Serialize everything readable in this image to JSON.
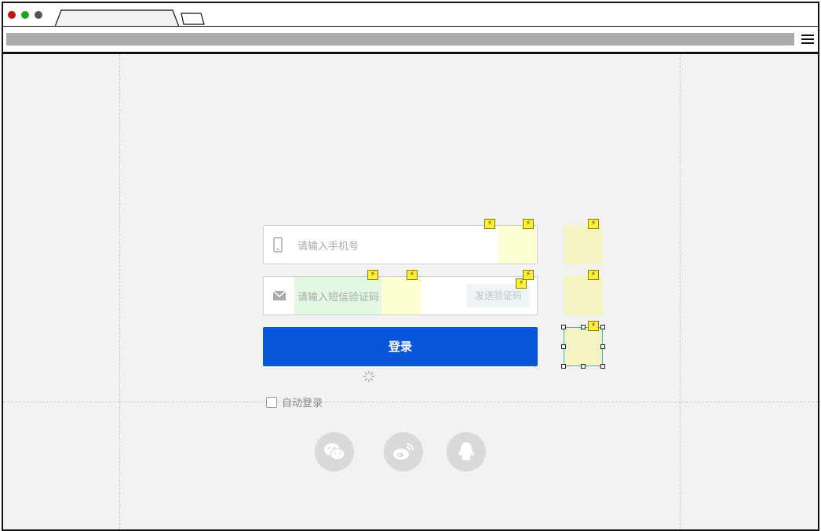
{
  "browser": {
    "dots": [
      "#c0170c",
      "#22a21e",
      "#555555"
    ]
  },
  "form": {
    "phone_placeholder": "请输入手机号",
    "code_placeholder": "请输入短信验证码",
    "send_code_label": "发送验证码",
    "login_label": "登录",
    "auto_login_label": "自动登录",
    "accent_color": "#0a56d8"
  },
  "social": [
    {
      "name": "wechat-icon"
    },
    {
      "name": "weibo-icon"
    },
    {
      "name": "qq-icon"
    }
  ],
  "hotspot_icon": "lightning-icon"
}
